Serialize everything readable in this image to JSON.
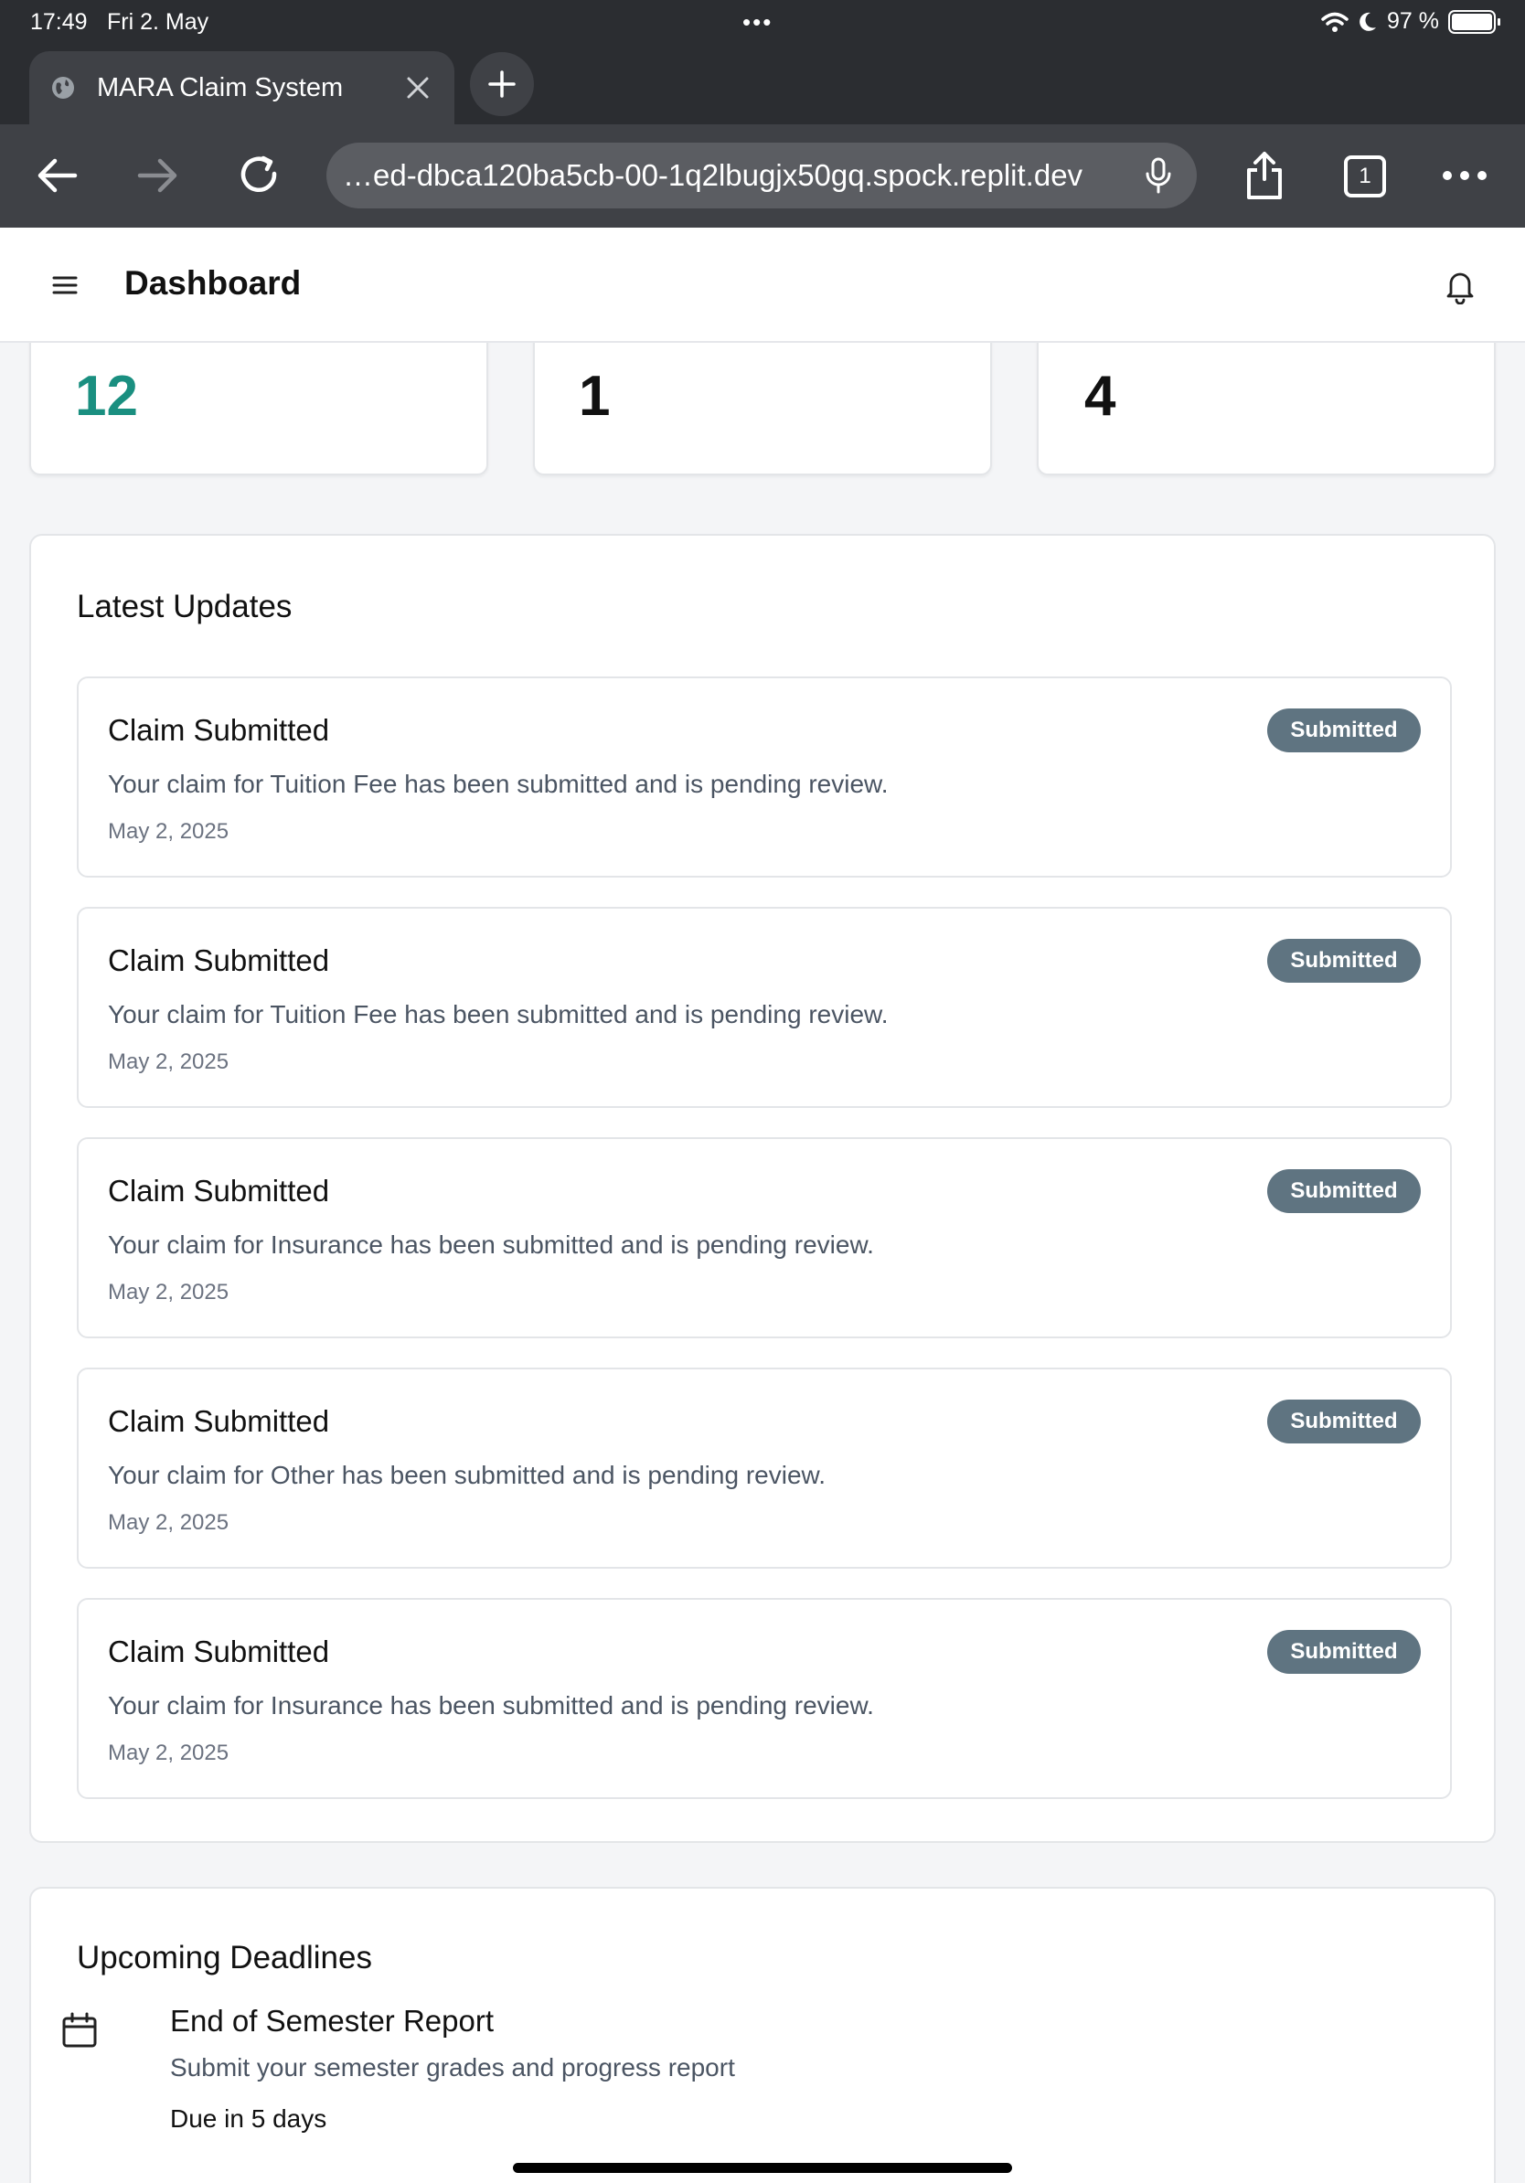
{
  "status_bar": {
    "time": "17:49",
    "date": "Fri 2. May",
    "battery": "97 %"
  },
  "browser": {
    "tab_title": "MARA Claim System",
    "url": "…ed-dbca120ba5cb-00-1q2lbugjx50gq.spock.replit.dev",
    "tab_count": "1"
  },
  "header": {
    "title": "Dashboard"
  },
  "stats": [
    {
      "value": "12",
      "accent": "#1a8f80"
    },
    {
      "value": "1"
    },
    {
      "value": "4"
    }
  ],
  "latest_updates": {
    "title": "Latest Updates",
    "items": [
      {
        "title": "Claim Submitted",
        "badge": "Submitted",
        "description": "Your claim for Tuition Fee has been submitted and is pending review.",
        "date": "May 2, 2025"
      },
      {
        "title": "Claim Submitted",
        "badge": "Submitted",
        "description": "Your claim for Tuition Fee has been submitted and is pending review.",
        "date": "May 2, 2025"
      },
      {
        "title": "Claim Submitted",
        "badge": "Submitted",
        "description": "Your claim for Insurance has been submitted and is pending review.",
        "date": "May 2, 2025"
      },
      {
        "title": "Claim Submitted",
        "badge": "Submitted",
        "description": "Your claim for Other has been submitted and is pending review.",
        "date": "May 2, 2025"
      },
      {
        "title": "Claim Submitted",
        "badge": "Submitted",
        "description": "Your claim for Insurance has been submitted and is pending review.",
        "date": "May 2, 2025"
      }
    ]
  },
  "deadlines": {
    "title": "Upcoming Deadlines",
    "items": [
      {
        "title": "End of Semester Report",
        "description": "Submit your semester grades and progress report",
        "due": "Due in 5 days"
      }
    ]
  },
  "colors": {
    "badge": "#5f7481",
    "teal_accent": "#1a8f80",
    "chrome": "#2b2d31"
  }
}
